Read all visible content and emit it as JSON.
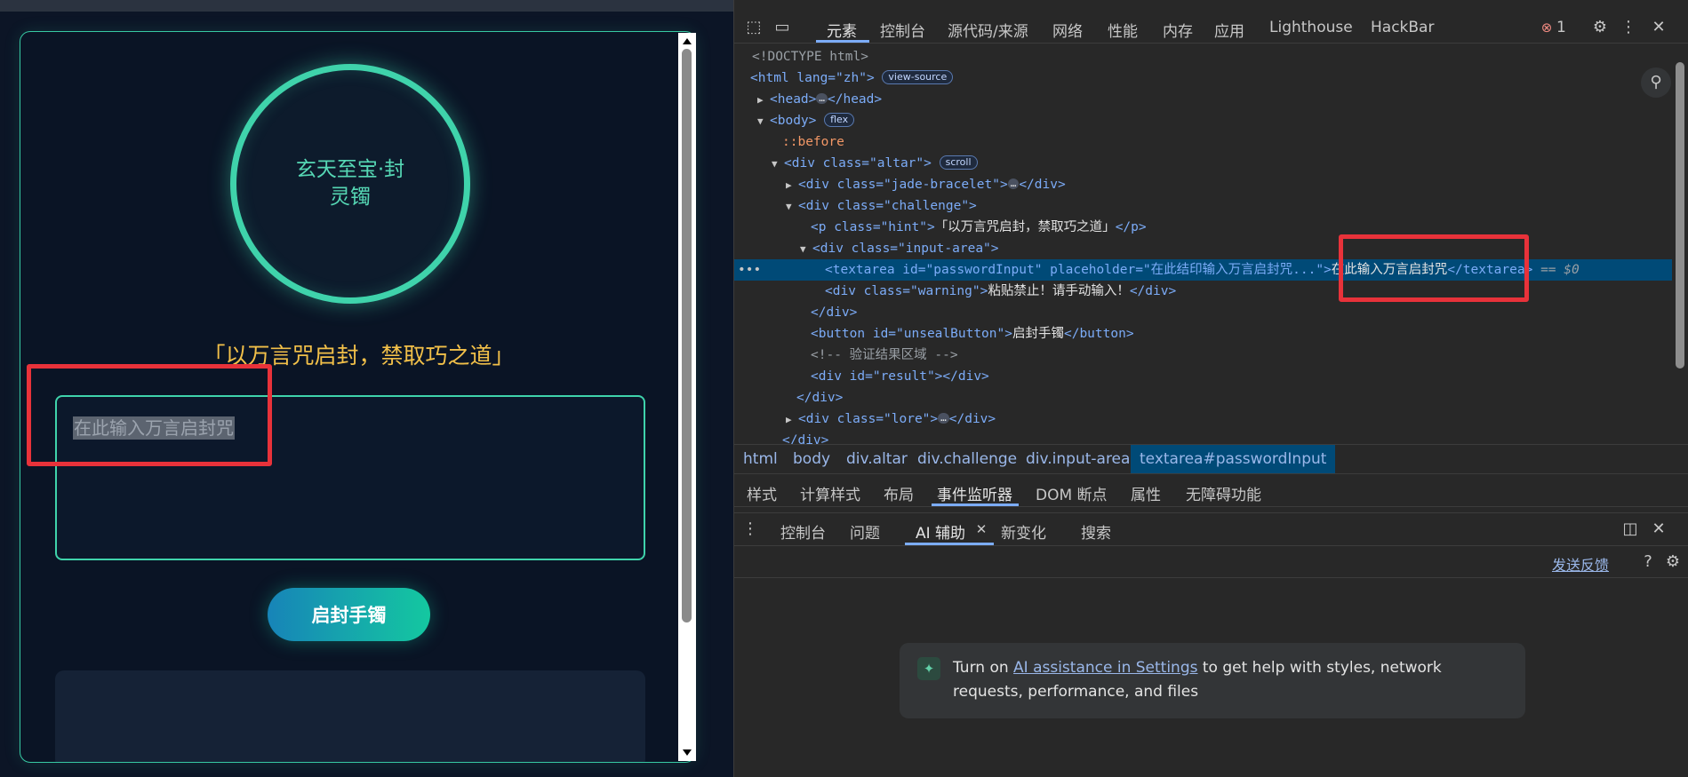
{
  "page": {
    "bracelet_text": "玄天至宝·封灵镯",
    "hint": "「以万言咒启封，禁取巧之道」",
    "password_value": "在此输入万言启封咒",
    "unseal_label": "启封手镯"
  },
  "devtools": {
    "tabs": [
      "元素",
      "控制台",
      "源代码/来源",
      "网络",
      "性能",
      "内存",
      "应用",
      "Lighthouse",
      "HackBar"
    ],
    "error_count": "1",
    "dom": {
      "doctype": "<!DOCTYPE html>",
      "html_open": "<html lang=\"zh\">",
      "view_source_badge": "view-source",
      "head": "<head>",
      "head_close": "</head>",
      "body_open": "<body>",
      "flex_badge": "flex",
      "before": "::before",
      "altar_open": "<div class=\"altar\">",
      "scroll_badge": "scroll",
      "jade_open": "<div class=\"jade-bracelet\">",
      "div_close": "</div>",
      "challenge_open": "<div class=\"challenge\">",
      "p_open": "<p class=\"hint\">",
      "p_text": "「以万言咒启封，禁取巧之道」",
      "p_close": "</p>",
      "input_area_open": "<div class=\"input-area\">",
      "textarea_open": "<textarea id=\"passwordInput\" placeholder=\"在此结印输入万言启封咒...\">",
      "textarea_text": "在此输入万言启封咒",
      "textarea_close": "</textarea>",
      "eq_marker": "== $0",
      "warning_open": "<div class=\"warning\">",
      "warning_text": "粘贴禁止！请手动输入！",
      "button_open": "<button id=\"unsealButton\">",
      "button_text": "启封手镯",
      "button_close": "</button>",
      "comment": "<!-- 验证结果区域 -->",
      "result_open": "<div id=\"result\">",
      "lore_open": "<div class=\"lore\">"
    },
    "breadcrumbs": [
      "html",
      "body",
      "div.altar",
      "div.challenge",
      "div.input-area",
      "textarea#passwordInput"
    ],
    "side_tabs": [
      "样式",
      "计算样式",
      "布局",
      "事件监听器",
      "DOM 断点",
      "属性",
      "无障碍功能"
    ],
    "drawer_tabs": [
      "控制台",
      "问题",
      "AI 辅助",
      "新变化",
      "搜索"
    ],
    "feedback": "发送反馈",
    "ai_card": {
      "prefix": "Turn on ",
      "link": "AI assistance in Settings",
      "suffix": " to get help with styles, network requests, performance, and files"
    }
  }
}
